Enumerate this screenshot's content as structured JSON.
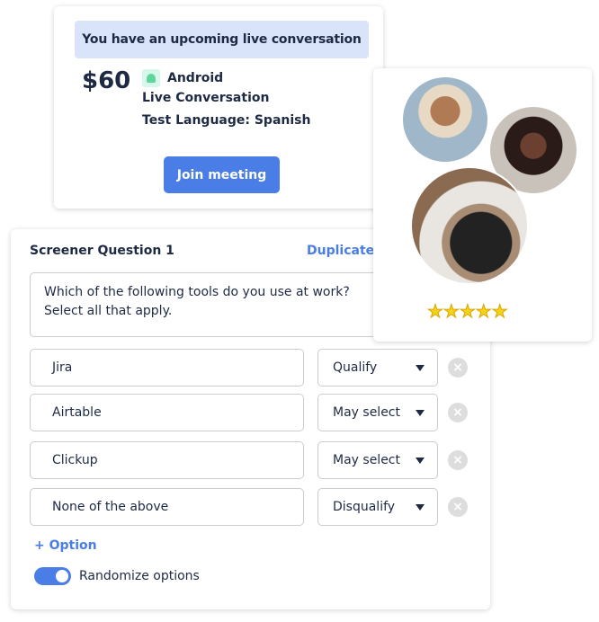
{
  "meeting_card": {
    "banner": "You have an upcoming live conversation",
    "price": "$60",
    "platform_icon": "android-icon",
    "platform": "Android",
    "type": "Live Conversation",
    "language": "Test Language: Spanish",
    "join_label": "Join meeting",
    "accent": "#4a7ee6"
  },
  "screener": {
    "title": "Screener Question 1",
    "duplicate_label": "Duplicate",
    "question": "Which of the following tools do you use at work? Select all that apply.",
    "options": [
      {
        "text": "Jira",
        "rule": "Qualify"
      },
      {
        "text": "Airtable",
        "rule": "May select"
      },
      {
        "text": "Clickup",
        "rule": "May select"
      },
      {
        "text": "None of the above",
        "rule": "Disqualify"
      }
    ],
    "add_option_label": "+ Option",
    "randomize_label": "Randomize options",
    "randomize_on": true
  },
  "participants": {
    "rating": 5,
    "stars": "★★★★★"
  }
}
